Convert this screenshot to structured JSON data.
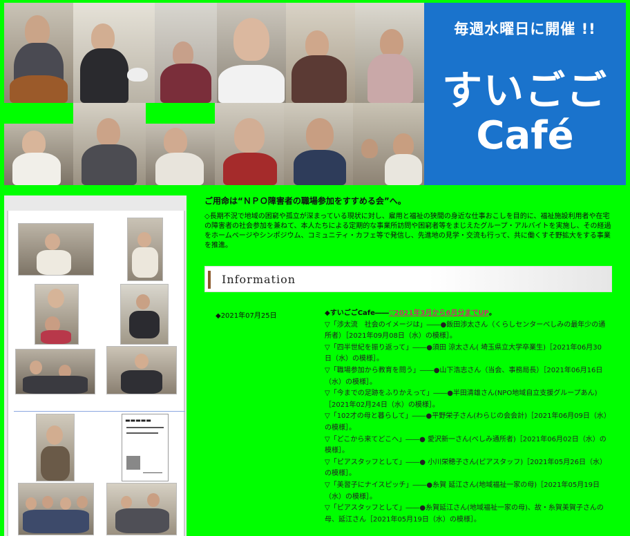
{
  "banner": {
    "promo_top": "毎週水曜日に開催 !!",
    "promo_name": "すいごご",
    "promo_cafe": "Café"
  },
  "main": {
    "headline": "ご用命は“ＮＰＯ障害者の職場参加をすすめる会”へ。",
    "intro": "◇長期不況で地域の困窮や孤立が深まっている現状に対し、雇用と福祉の狭間の身近な仕事おこしを目的に、福祉施設利用者や在宅の障害者の社会参加を兼ねて、本人たちによる定期的な事業所訪問や困窮者等をまじえたグループ・アルバイトを実施し、その経過をホームページやシンポジウム、コミュニティ・カフェ等で発信し、先進地の見学・交流も行って、共に働くすそ野拡大をする事業を推進。"
  },
  "information": {
    "title": "Information",
    "date": "◆2021年07月25日",
    "lead_prefix": "◆すいごごCafe――",
    "lead_link": "▽2021年3月から6月分までUP",
    "lead_suffix": "。",
    "items": [
      "▽「渉太流　社会のイメージは」――●飯田渉太さん（くらしセンターべしみの最年少の通所者）［2021年09月08日（水）の模様］。",
      "▽「四半世紀を振り返って」――●須田 涼太さん( 埼玉県立大学卒業生)［2021年06月30日（水）の模様］。",
      "▽「職場参加から教育を問う」――●山下浩志さん（当会、事務局長）［2021年06月16日（水）の模様］。",
      "▽「今までの足跡をふりかえって」――●半田清雄さん(NPO地域自立支援グループあん)［2021年02月24日（水）の模様］。",
      "▽「102才の母と暮らして」――●平野栄子さん(わらじの会会計)［2021年06月09日（水）の模様］。",
      "▽「どこから来てどこへ」――● 愛沢新一さん(べしみ通所者)［2021年06月02日（水）の模様］。",
      "▽「ピアスタッフとして」――● 小川栄穂子さん(ピアスタッフ)［2021年05月26日（水）の模様］。",
      "▽「美習子にナイスピッチ」――●糸賀 延江さん(地域福祉一家の母)［2021年05月19日（水）の模様］。",
      "▽「ピアスタッフとして」――●糸賀延江さん(地域福祉一家の母)、故・糸賀美賀子さんの母、延江さん［2021年05月19日（水）の模様］。"
    ]
  },
  "colors": {
    "background": "#00ff00",
    "promo_blue": "#1a73cc",
    "link": "#cc2a6e",
    "accent_bar": "#8b5a2b"
  }
}
